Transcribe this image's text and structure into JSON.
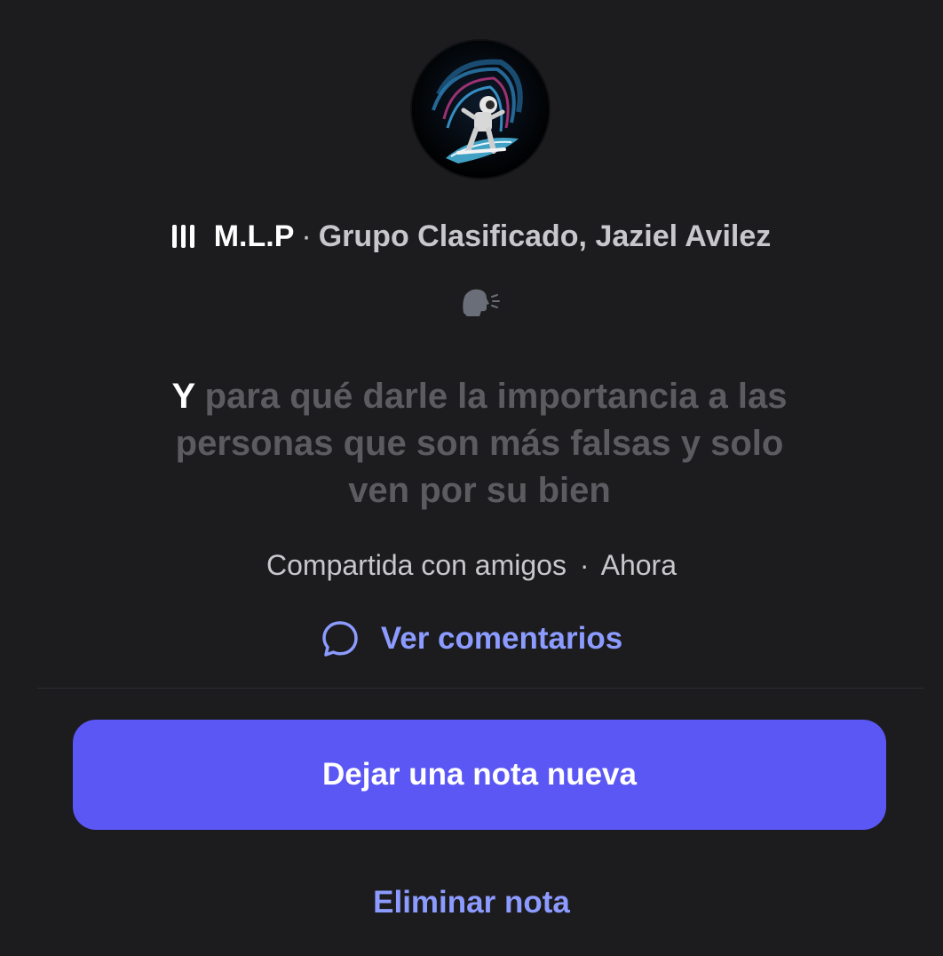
{
  "music": {
    "song": "M.L.P",
    "separator": "·",
    "artists": "Grupo Clasificado, Jaziel Avilez"
  },
  "icons": {
    "music": "equalizer-bars-icon",
    "status": "speaking-head-icon",
    "comments": "speech-bubble-icon",
    "avatar": "astronaut-surfing-wave-avatar"
  },
  "note": {
    "first_word": "Y",
    "rest": " para qué darle la importancia a las personas que son más falsas y solo ven por su bien"
  },
  "meta": {
    "audience": "Compartida con amigos",
    "separator": "·",
    "time": "Ahora"
  },
  "comments_label": "Ver comentarios",
  "primary_button_label": "Dejar una nota nueva",
  "delete_label": "Eliminar nota",
  "colors": {
    "background": "#1c1c1e",
    "accent": "#5b57f5",
    "link": "#8c9bff",
    "muted_text": "#5c5c60"
  }
}
